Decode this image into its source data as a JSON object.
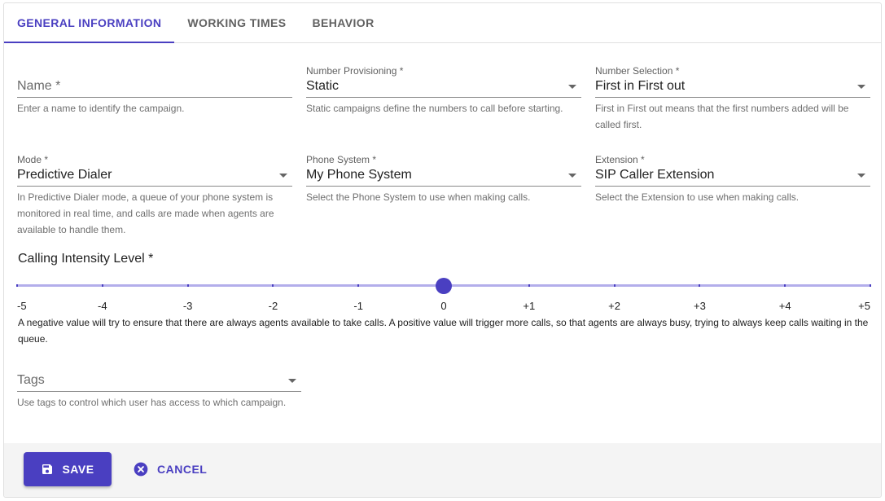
{
  "tabs": [
    {
      "label": "GENERAL INFORMATION",
      "active": true
    },
    {
      "label": "WORKING TIMES",
      "active": false
    },
    {
      "label": "BEHAVIOR",
      "active": false
    }
  ],
  "fields": {
    "name": {
      "placeholder": "Name *",
      "help": "Enter a name to identify the campaign."
    },
    "number_provisioning": {
      "label": "Number Provisioning *",
      "value": "Static",
      "help": "Static campaigns define the numbers to call before starting."
    },
    "number_selection": {
      "label": "Number Selection *",
      "value": "First in First out",
      "help": "First in First out means that the first numbers added will be called first."
    },
    "mode": {
      "label": "Mode *",
      "value": "Predictive Dialer",
      "help": "In Predictive Dialer mode, a queue of your phone system is monitored in real time, and calls are made when agents are available to handle them."
    },
    "phone_system": {
      "label": "Phone System *",
      "value": "My Phone System",
      "help": "Select the Phone System to use when making calls."
    },
    "extension": {
      "label": "Extension *",
      "value": "SIP Caller Extension",
      "help": "Select the Extension to use when making calls."
    },
    "tags": {
      "placeholder": "Tags",
      "help": "Use tags to control which user has access to which campaign."
    }
  },
  "slider": {
    "title": "Calling Intensity Level *",
    "min": -5,
    "max": 5,
    "value": 0,
    "marks": [
      "-5",
      "-4",
      "-3",
      "-2",
      "-1",
      "0",
      "+1",
      "+2",
      "+3",
      "+4",
      "+5"
    ],
    "help": "A negative value will try to ensure that there are always agents available to take calls. A positive value will trigger more calls, so that agents are always busy, trying to always keep calls waiting in the queue."
  },
  "footer": {
    "save_label": "SAVE",
    "cancel_label": "CANCEL"
  },
  "colors": {
    "accent": "#4a3fc1",
    "track": "#b3aeeb"
  }
}
